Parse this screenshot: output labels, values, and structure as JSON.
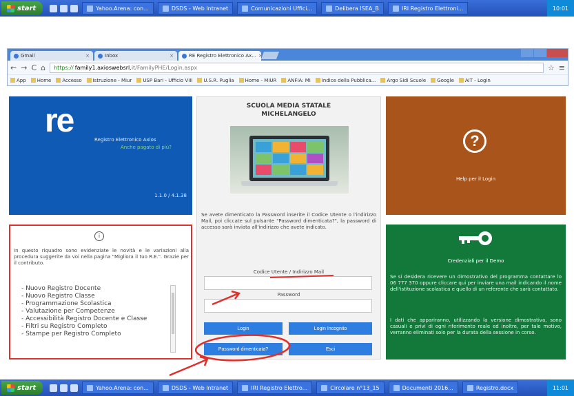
{
  "taskbar_top": {
    "start_label": "start",
    "tasks": [
      "Yahoo.Arena: con...",
      "DSDS - Web Intranet",
      "Comunicazioni Uffici...",
      "Delibera ISEA_B",
      "IRI Registro Elettroni..."
    ],
    "clock": "10:01"
  },
  "taskbar_bottom": {
    "start_label": "start",
    "tasks": [
      "Yahoo.Arena: con...",
      "DSDS - Web Intranet",
      "IRI Registro Elettro...",
      "Circolare n°13_15",
      "Documenti 2016...",
      "Registro.docx"
    ],
    "clock": "11:01"
  },
  "browser": {
    "tabs": [
      {
        "label": "Gmail",
        "active": false
      },
      {
        "label": "Inbox",
        "active": false
      },
      {
        "label": "RE Registro Elettronico Ax...",
        "active": true
      }
    ],
    "url_scheme": "https://",
    "url_host": "family1.axioswebsrl.",
    "url_path": "it/FamilyPHE/Login.aspx",
    "bookmarks": [
      "App",
      "Home",
      "Accesso",
      "Istruzione - Miur",
      "USP Bari - Ufficio VIII",
      "U.S.R. Puglia",
      "Home - MIUR",
      "ANFIA: MI",
      "Indice della Pubblica...",
      "Argo Sidi Scuole",
      "Google",
      "AIT - Login"
    ]
  },
  "re_tile": {
    "logo": "re",
    "title": "Registro Elettronico Axios",
    "link": "Anche pagato di più?",
    "version": "1.1.0 / 4.1.38"
  },
  "login_tile": {
    "school_line1": "SCUOLA MEDIA STATALE",
    "school_line2": "MICHELANGELO",
    "forgot_text": "Se avete dimenticato la Password inserite il Codice Utente o l'indirizzo Mail, poi cliccate sul pulsante \"Password dimenticata?\", la password di accesso sarà inviata all'indirizzo che avete indicato.",
    "user_label": "Codice Utente / Indirizzo Mail",
    "password_label": "Password",
    "login_button": "Login",
    "login_incognito_button": "Login Incognito",
    "forgot_button": "Password dimenticata?",
    "exit_button": "Esci"
  },
  "help_tile": {
    "icon": "?",
    "label": "Help per il Login"
  },
  "news_tile": {
    "icon": "info",
    "text": "In questo riquadro sono evidenziate le novità e le variazioni alla procedura suggerite da voi nella pagina \"Migliora il tuo R.E.\". Grazie per il contributo.",
    "items": [
      "- Nuovo Registro Docente",
      "- Nuovo Registro Classe",
      "- Programmazione Scolastica",
      "- Valutazione per Competenze",
      "- Accessibilità Registro Docente e Classe",
      "- Filtri su Registro Completo",
      "- Stampe per Registro Completo"
    ]
  },
  "cred_tile": {
    "title": "Credenziali per il Demo",
    "text1": "Se si desidera ricevere un dimostrativo del programma contattare lo 06 777 370 oppure cliccare qui per inviare una mail indicando il nome dell'istituzione scolastica e quello di un referente che sarà contattato.",
    "text2": "I dati che appariranno, utilizzando la versione dimostrativa, sono casuali e privi di ogni riferimento reale ed inoltre, per tale motivo, verranno eliminati solo per la durata della sessione in corso."
  },
  "colors": {
    "taskbar": "#2451b8",
    "re_blue": "#0e5ab4",
    "help_brown": "#a8541b",
    "cred_green": "#12793b",
    "button_blue": "#2e7de0",
    "annotation_red": "#e0302c"
  }
}
